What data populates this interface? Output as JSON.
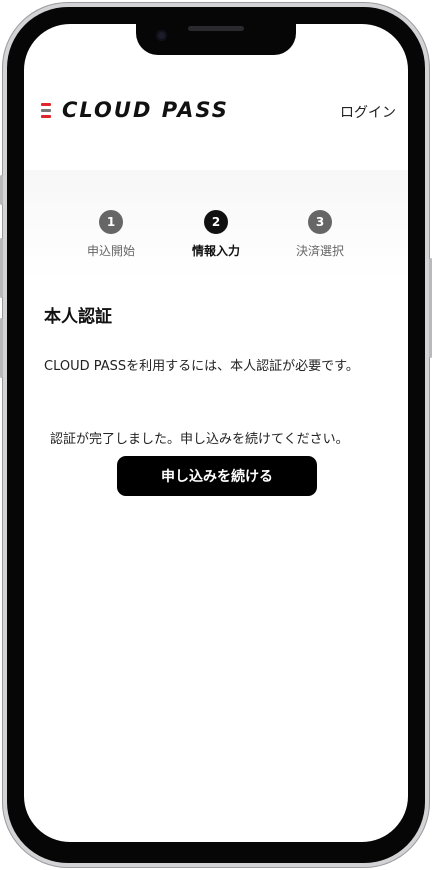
{
  "app": {
    "logo_text": "CLOUD PASS",
    "brand_colors": {
      "red": "#e0242c",
      "gray": "#777777",
      "dark": "#111111"
    }
  },
  "header": {
    "login_label": "ログイン"
  },
  "stepper": {
    "steps": [
      {
        "number": "1",
        "label": "申込開始",
        "state": "done"
      },
      {
        "number": "2",
        "label": "情報入力",
        "state": "active"
      },
      {
        "number": "3",
        "label": "決済選択",
        "state": "pending"
      }
    ],
    "colors": {
      "active": "#111111",
      "inactive": "#666666"
    }
  },
  "main": {
    "title": "本人認証",
    "description": "CLOUD PASSを利用するには、本人認証が必要です。",
    "status_message": "認証が完了しました。申し込みを続けてください。",
    "continue_button": "申し込みを続ける"
  }
}
